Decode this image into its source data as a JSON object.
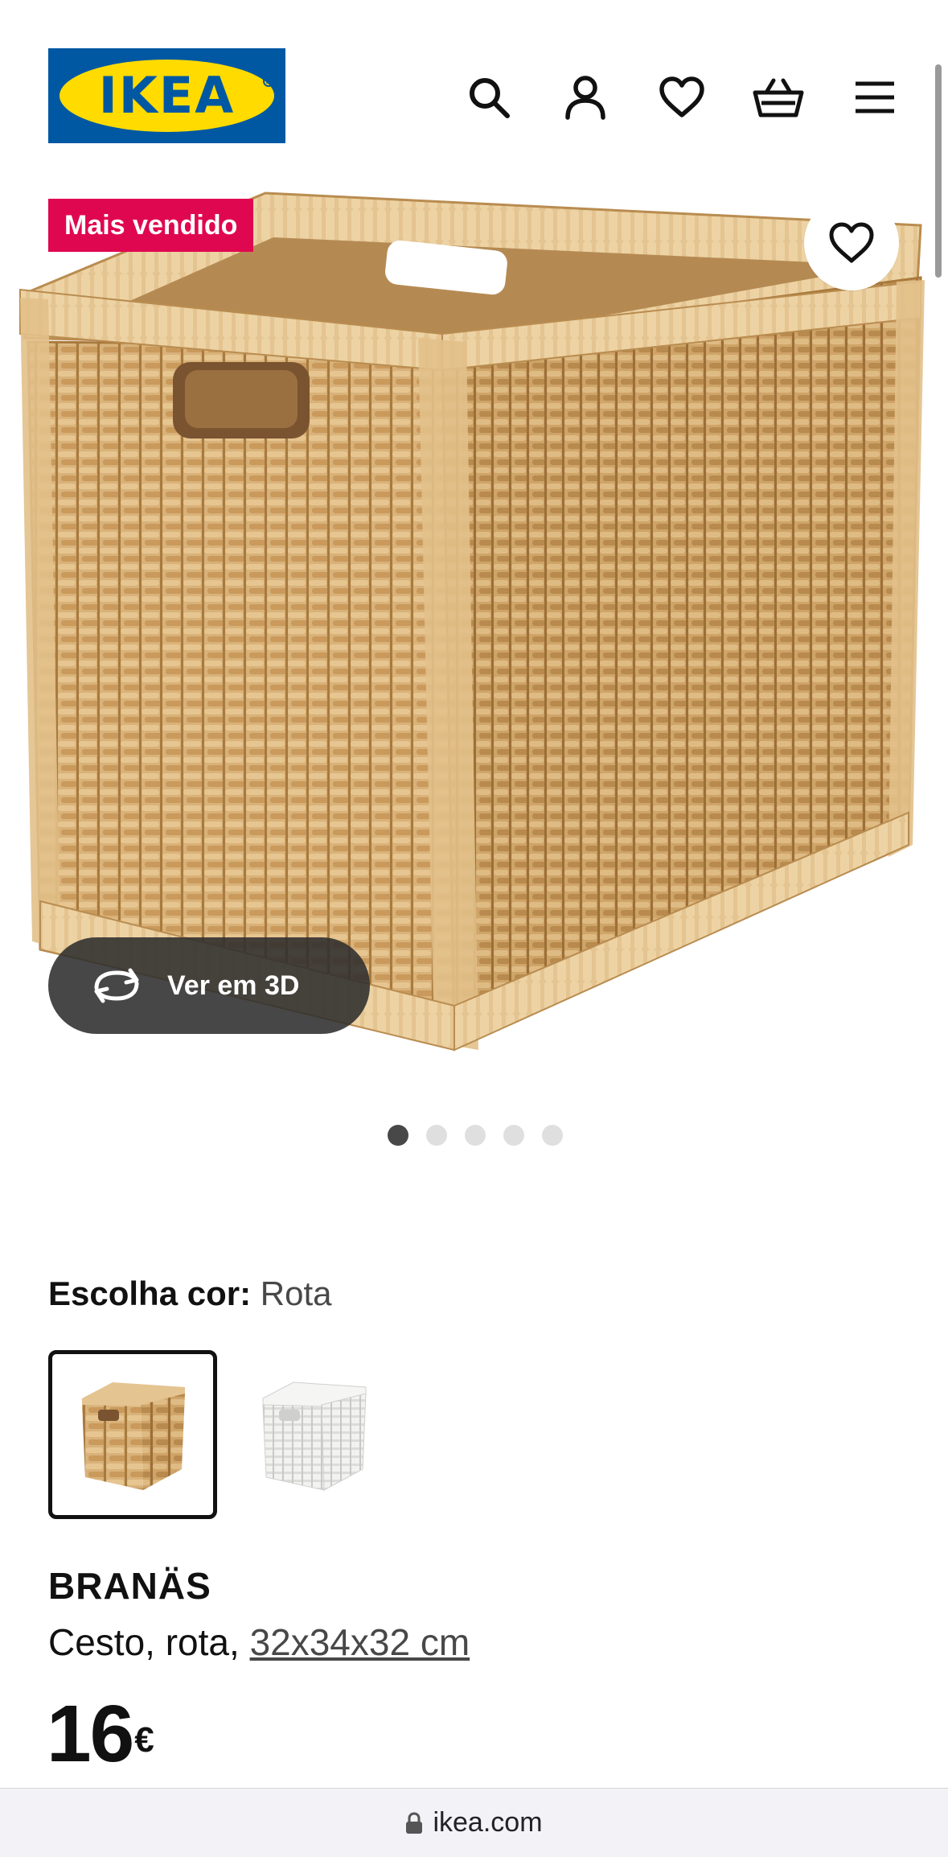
{
  "header": {
    "logo_text": "IKEA",
    "icons": [
      "search-icon",
      "user-icon",
      "heart-icon",
      "basket-icon",
      "menu-icon"
    ]
  },
  "product_image": {
    "badge": "Mais vendido",
    "view_3d_label": "Ver em 3D",
    "carousel_total": 5,
    "carousel_active": 1
  },
  "color_selector": {
    "label": "Escolha cor:",
    "value": "Rota",
    "options": [
      "Rota",
      "Branco"
    ],
    "selected_index": 0
  },
  "product": {
    "name": "BRANÄS",
    "description": "Cesto, rota, ",
    "dimensions": "32x34x32 cm",
    "price": "16",
    "currency": "€"
  },
  "browser": {
    "url": "ikea.com"
  },
  "colors": {
    "ikea_blue": "#0058a3",
    "ikea_yellow": "#ffdb00",
    "badge_red": "#e00751",
    "text_dark": "#111111",
    "text_grey": "#484848"
  }
}
